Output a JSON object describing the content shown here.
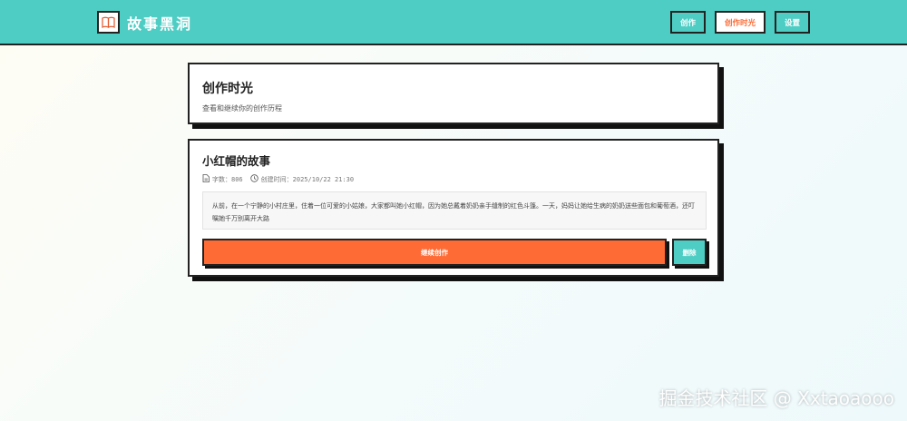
{
  "header": {
    "app_title": "故事黑洞",
    "logo_icon": "book-open-icon",
    "nav": [
      {
        "label": "创作",
        "active": false
      },
      {
        "label": "创作时光",
        "active": true
      },
      {
        "label": "设置",
        "active": false
      }
    ]
  },
  "page": {
    "title": "创作时光",
    "subtitle": "查看和继续你的创作历程"
  },
  "story": {
    "title": "小红帽的故事",
    "word_count_label": "字数：806",
    "created_label": "创建时间：2025/10/22 21:30",
    "excerpt": "从前，在一个宁静的小村庄里，住着一位可爱的小姑娘，大家都叫她小红帽，因为她总戴着奶奶亲手缝制的红色斗篷。一天，妈妈让她给生病的奶奶送些面包和葡萄酒，还叮嘱她千万别离开大路",
    "continue_label": "继续创作",
    "delete_label": "删除"
  },
  "watermark": "掘金技术社区 @ Xxtaoaooo",
  "colors": {
    "header_bg": "#4ecdc4",
    "accent_orange": "#ff6b35",
    "accent_teal": "#4ecdc4",
    "border": "#222222"
  }
}
